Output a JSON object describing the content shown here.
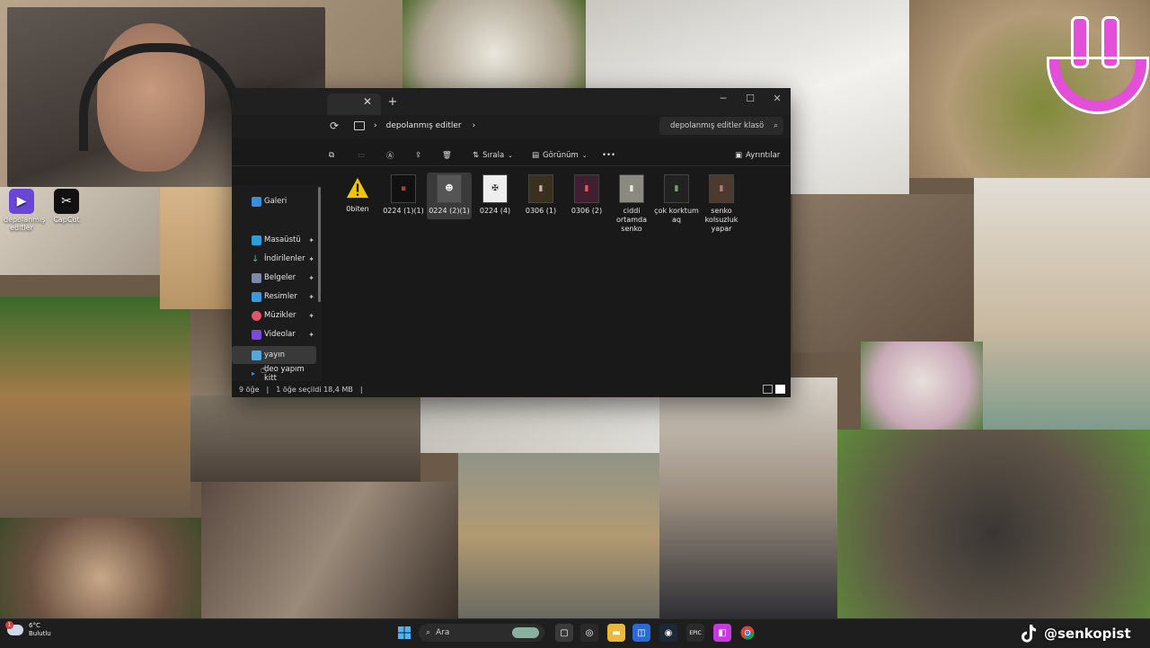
{
  "explorer": {
    "tab_close": "✕",
    "tab_add": "+",
    "window_controls": {
      "minimize": "─",
      "maximize": "☐",
      "close": "✕"
    },
    "address": {
      "refresh": "⟳",
      "path_sep": "›",
      "path": "depolanmış editler"
    },
    "search_placeholder": "depolanmış editler klasö",
    "commands": {
      "sort": "Sırala",
      "view": "Görünüm",
      "more": "•••",
      "details": "Ayrıntılar"
    },
    "files": [
      {
        "name": "0biten",
        "kind": "warning"
      },
      {
        "name": "0224 (1)(1)",
        "kind": "video"
      },
      {
        "name": "0224 (2)(1)",
        "kind": "video",
        "selected": true
      },
      {
        "name": "0224 (4)",
        "kind": "video"
      },
      {
        "name": "0306 (1)",
        "kind": "video"
      },
      {
        "name": "0306 (2)",
        "kind": "video"
      },
      {
        "name": "ciddi ortamda senko",
        "kind": "video"
      },
      {
        "name": "çok korktum aq",
        "kind": "video"
      },
      {
        "name": "senko kolsuzluk yapar",
        "kind": "video"
      }
    ],
    "nav": [
      {
        "label": "Galeri",
        "pinned": false
      },
      {
        "label": "Masaüstü",
        "pinned": true
      },
      {
        "label": "İndirilenler",
        "pinned": true
      },
      {
        "label": "Belgeler",
        "pinned": true
      },
      {
        "label": "Resimler",
        "pinned": true
      },
      {
        "label": "Müzikler",
        "pinned": true
      },
      {
        "label": "Videolar",
        "pinned": true
      },
      {
        "label": "yayın",
        "pinned": false,
        "active": true
      },
      {
        "label": "deo yapım kitt",
        "pinned": false
      }
    ],
    "status": {
      "count": "9 öğe",
      "selected": "1 öğe seçildi 18,4 MB"
    }
  },
  "desktop_icons": [
    {
      "label": "depolanmış editler"
    },
    {
      "label": "CapCut"
    }
  ],
  "taskbar": {
    "weather_temp": "6°C",
    "weather_desc": "Bulutlu",
    "weather_badge": "1",
    "search_label": "Ara"
  },
  "overlay": {
    "tiktok_handle": "@senkopist"
  },
  "colors": {
    "accent_pink": "#e34fd8",
    "warning_yellow": "#f5c400",
    "explorer_bg": "#191919"
  }
}
